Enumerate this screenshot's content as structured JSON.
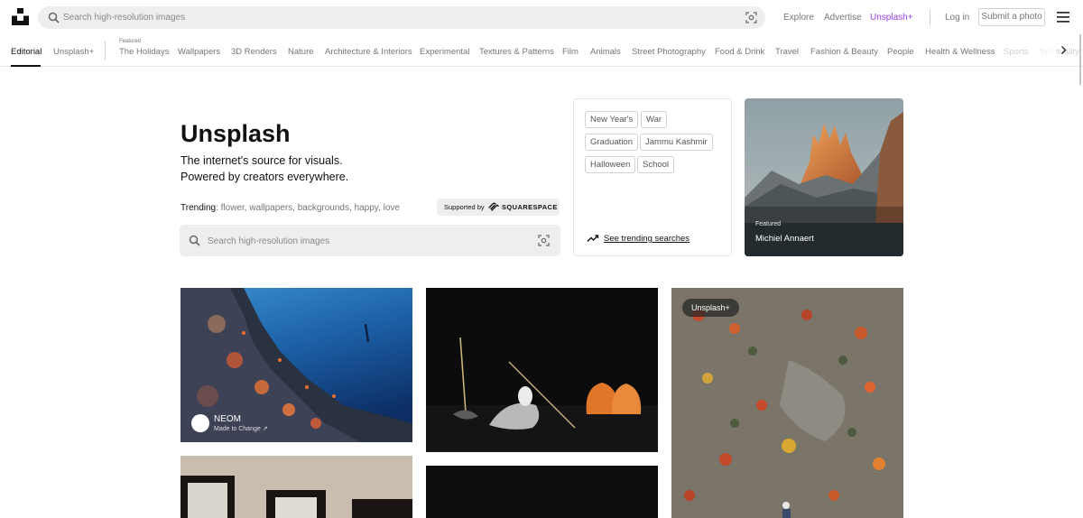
{
  "header": {
    "search_placeholder": "Search high-resolution images",
    "explore": "Explore",
    "advertise": "Advertise",
    "unsplash_plus": "Unsplash+",
    "login": "Log in",
    "submit": "Submit a photo",
    "plus_color": "#9b3fe0"
  },
  "nav": {
    "editorial": "Editorial",
    "unsplash_plus": "Unsplash+",
    "featured_label": "Featured",
    "items": [
      "The Holidays",
      "Wallpapers",
      "3D Renders",
      "Nature",
      "Architecture & Interiors",
      "Experimental",
      "Textures & Patterns",
      "Film",
      "Animals",
      "Street Photography",
      "Food & Drink",
      "Travel",
      "Fashion & Beauty",
      "People",
      "Health & Wellness",
      "Sports",
      "Spirituality"
    ]
  },
  "hero": {
    "title": "Unsplash",
    "line1": "The internet's source for visuals.",
    "line2": "Powered by creators everywhere.",
    "trending_label": "Trending",
    "trending": [
      "flower",
      "wallpapers",
      "backgrounds",
      "happy",
      "love"
    ],
    "supported_by": "Supported by",
    "sponsor": "SQUARESPACE",
    "search_placeholder": "Search high-resolution images"
  },
  "trend_card": {
    "chips": [
      "New Year's",
      "War",
      "Graduation",
      "Jammu Kashmir",
      "Halloween",
      "School"
    ],
    "see_trending": "See trending searches"
  },
  "featured": {
    "label": "Featured",
    "author": "Michiel Annaert"
  },
  "grid": {
    "photo1": {
      "author": "NEOM",
      "subtitle": "Made to Change ↗"
    },
    "photo3": {
      "badge": "Unsplash+"
    }
  }
}
